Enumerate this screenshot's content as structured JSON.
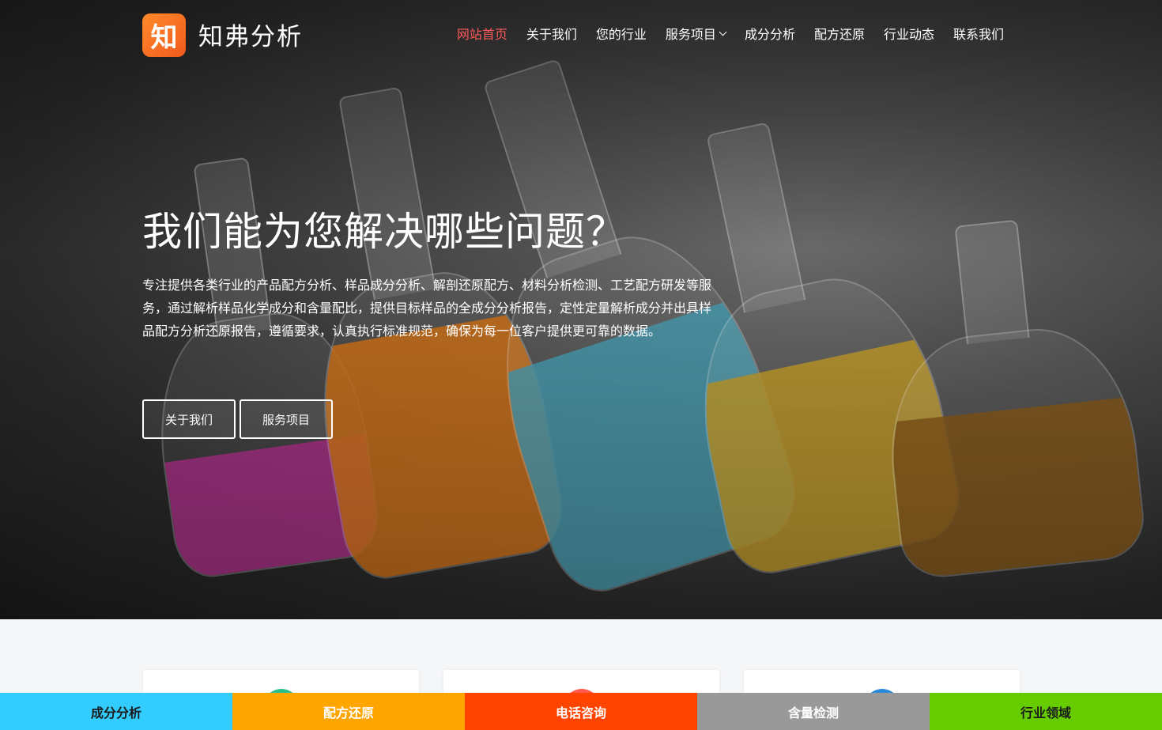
{
  "brand": {
    "logo_char": "知",
    "name": "知弗分析"
  },
  "nav": {
    "items": [
      {
        "label": "网站首页",
        "active": true
      },
      {
        "label": "关于我们"
      },
      {
        "label": "您的行业"
      },
      {
        "label": "服务项目",
        "dropdown": true
      },
      {
        "label": "成分分析"
      },
      {
        "label": "配方还原"
      },
      {
        "label": "行业动态"
      },
      {
        "label": "联系我们"
      }
    ]
  },
  "hero": {
    "title": "我们能为您解决哪些问题？",
    "description": "专注提供各类行业的产品配方分析、样品成分分析、解剖还原配方、材料分析检测、工艺配方研发等服务，通过解析样品化学成分和含量配比，提供目标样品的全成分分析报告，定性定量解析成分并出具样品配方分析还原报告，遵循要求，认真执行标准规范，确保为每一位客户提供更可靠的数据。",
    "buttons": {
      "about": "关于我们",
      "services": "服务项目"
    }
  },
  "bottom_bar": [
    {
      "label": "成分分析",
      "bg": "#33ccff",
      "fg": "#1a1a1a"
    },
    {
      "label": "配方还原",
      "bg": "#ffa500",
      "fg": "#ffffff"
    },
    {
      "label": "电话咨询",
      "bg": "#ff4400",
      "fg": "#ffffff"
    },
    {
      "label": "含量检测",
      "bg": "#999999",
      "fg": "#ffffff"
    },
    {
      "label": "行业领域",
      "bg": "#66cc00",
      "fg": "#1a1a1a"
    }
  ],
  "colors": {
    "nav_active": "#ff5a5a",
    "logo_bg": "#f36b21"
  }
}
